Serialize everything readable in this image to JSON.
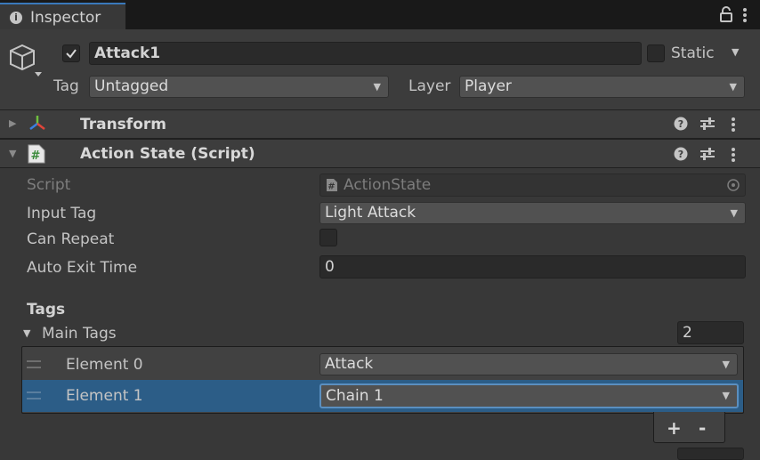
{
  "tab": {
    "title": "Inspector",
    "icon": "info-icon"
  },
  "toolbar": {
    "lock_icon": "lock-icon",
    "more_icon": "kebab-menu-icon"
  },
  "gameobject": {
    "active": true,
    "name": "Attack1",
    "static_label": "Static",
    "static_checked": false,
    "tag_label": "Tag",
    "tag_value": "Untagged",
    "layer_label": "Layer",
    "layer_value": "Player"
  },
  "components": {
    "transform": {
      "title": "Transform",
      "expanded": false
    },
    "action_state": {
      "title": "Action State (Script)",
      "expanded": true,
      "script_label": "Script",
      "script_value": "ActionState",
      "input_tag_label": "Input Tag",
      "input_tag_value": "Light Attack",
      "can_repeat_label": "Can Repeat",
      "can_repeat_checked": false,
      "auto_exit_label": "Auto Exit Time",
      "auto_exit_value": "0",
      "tags_header": "Tags",
      "main_tags_label": "Main Tags",
      "main_tags_count": "2",
      "elements": [
        {
          "label": "Element 0",
          "value": "Attack",
          "selected": false
        },
        {
          "label": "Element 1",
          "value": "Chain 1",
          "selected": true
        }
      ],
      "add_label": "+",
      "remove_label": "-"
    }
  },
  "colors": {
    "accent": "#2c5d87",
    "tab_highlight": "#3a79bb",
    "background": "#383838"
  }
}
